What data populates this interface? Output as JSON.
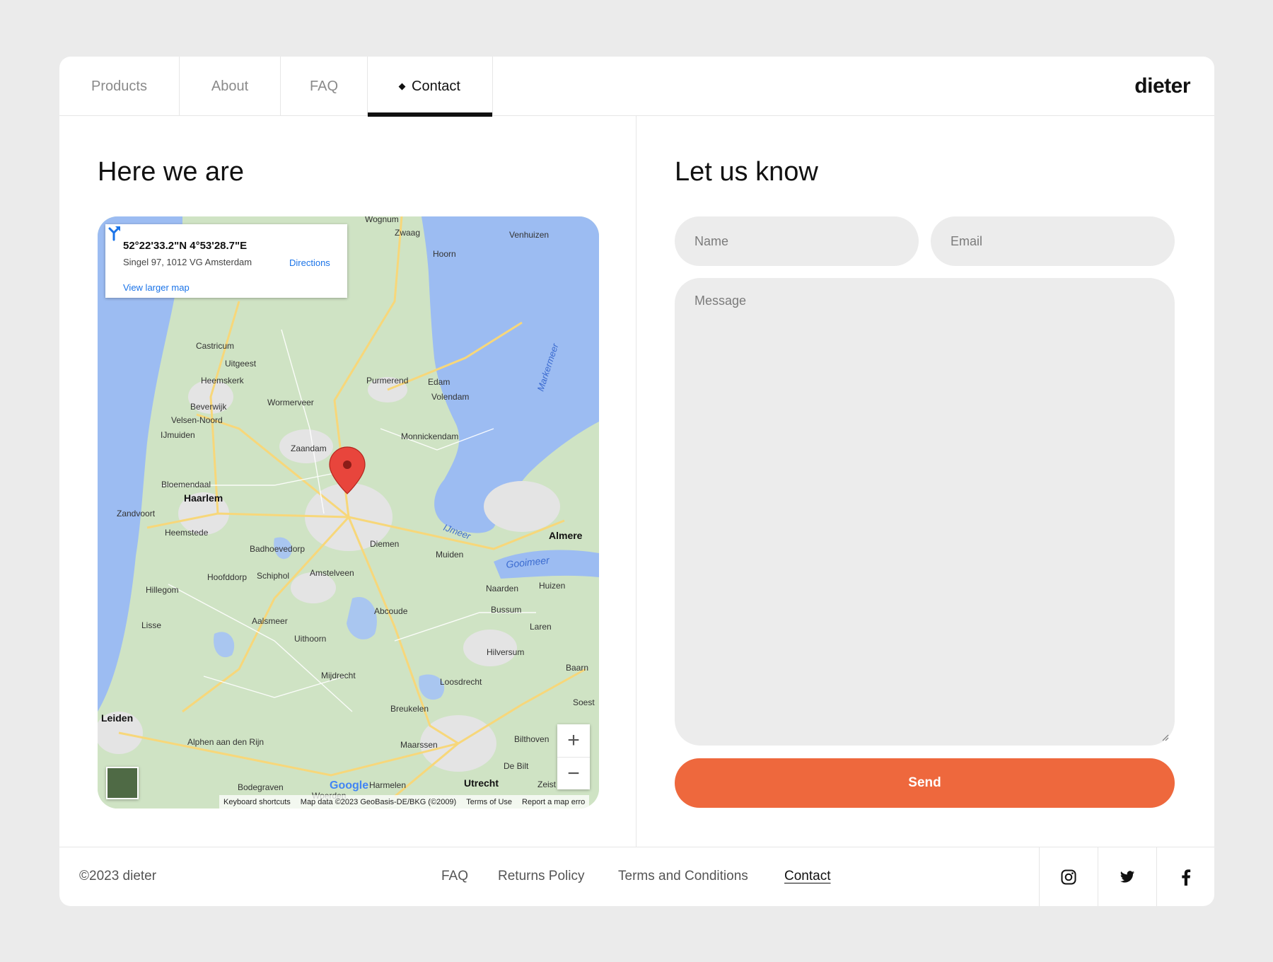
{
  "brand": {
    "logo": "dieter"
  },
  "nav": {
    "tabs": [
      {
        "label": "Products"
      },
      {
        "label": "About"
      },
      {
        "label": "FAQ"
      },
      {
        "label": "Contact",
        "active": true
      }
    ]
  },
  "location": {
    "heading": "Here we are",
    "map": {
      "coordinates": "52°22'33.2\"N 4°53'28.7\"E",
      "address": "Singel 97, 1012 VG Amsterdam",
      "directions_label": "Directions",
      "larger_map_label": "View larger map",
      "google_label": "Google",
      "attribution": {
        "shortcuts": "Keyboard shortcuts",
        "map_data": "Map data ©2023 GeoBasis-DE/BKG (©2009)",
        "terms": "Terms of Use",
        "report": "Report a map erro"
      },
      "places": [
        "Wognum",
        "Zwaag",
        "Venhuizen",
        "Hoorn",
        "Castricum",
        "Uitgeest",
        "Heemskerk",
        "Beverwijk",
        "Velsen-Noord",
        "IJmuiden",
        "Wormerveer",
        "Purmerend",
        "Edam",
        "Volendam",
        "Monnickendam",
        "Zaandam",
        "Bloemendaal",
        "Haarlem",
        "Zandvoort",
        "Heemstede",
        "Badhoevedorp",
        "Hoofddorp",
        "Schiphol",
        "Amstelveen",
        "Diemen",
        "Muiden",
        "Almere",
        "Naarden",
        "Huizen",
        "Bussum",
        "Laren",
        "Hillegom",
        "Lisse",
        "Aalsmeer",
        "Abcoude",
        "Uithoorn",
        "Hilversum",
        "Baarn",
        "Mijdrecht",
        "Loosdrecht",
        "Soest",
        "Leiden",
        "Breukelen",
        "Alphen aan den Rijn",
        "Maarssen",
        "Bilthoven",
        "De Bilt",
        "Bodegraven",
        "Woerden",
        "Harmelen",
        "Utrecht",
        "Zeist",
        "Markermeer",
        "IJmeer",
        "Gooimeer"
      ]
    }
  },
  "form": {
    "heading": "Let us know",
    "name_placeholder": "Name",
    "email_placeholder": "Email",
    "message_placeholder": "Message",
    "send_label": "Send"
  },
  "footer": {
    "copyright": "©2023 dieter",
    "links": [
      {
        "label": "FAQ"
      },
      {
        "label": "Returns Policy"
      },
      {
        "label": "Terms and Conditions"
      },
      {
        "label": "Contact",
        "active": true
      }
    ],
    "social": [
      "instagram-icon",
      "twitter-icon",
      "facebook-icon"
    ]
  },
  "colors": {
    "accent": "#ee683d",
    "background": "#ebebeb",
    "field": "#ececec",
    "water": "#9cbcf2",
    "land": "#cfe3c4"
  }
}
